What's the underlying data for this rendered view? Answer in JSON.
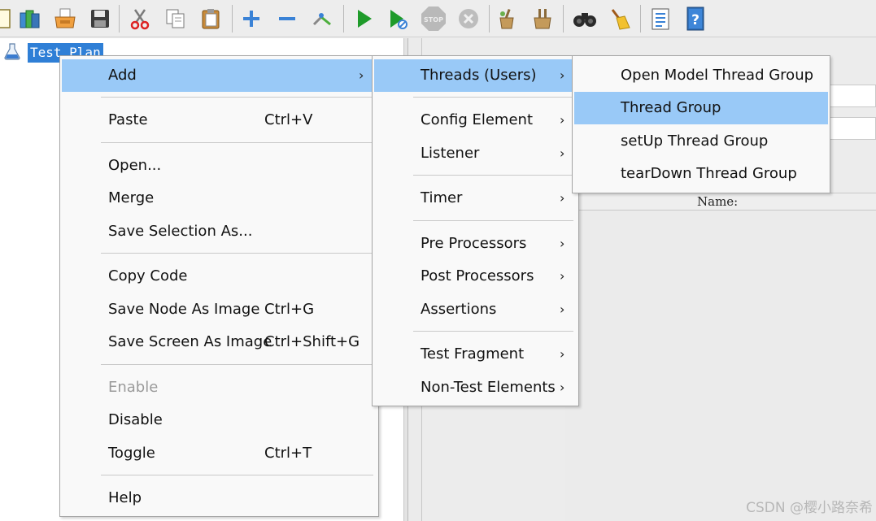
{
  "toolbar": {
    "buttons": [
      {
        "icon": "new-file-icon"
      },
      {
        "icon": "templates-icon"
      },
      {
        "icon": "open-icon"
      },
      {
        "icon": "save-icon"
      },
      {
        "icon": "cut-icon"
      },
      {
        "icon": "copy-icon"
      },
      {
        "icon": "paste-icon"
      },
      {
        "icon": "expand-icon"
      },
      {
        "icon": "collapse-icon"
      },
      {
        "icon": "toggle-icon"
      },
      {
        "icon": "start-icon"
      },
      {
        "icon": "start-no-pauses-icon"
      },
      {
        "icon": "stop-icon"
      },
      {
        "icon": "shutdown-icon"
      },
      {
        "icon": "clear-icon"
      },
      {
        "icon": "clear-all-icon"
      },
      {
        "icon": "search-icon"
      },
      {
        "icon": "reset-search-icon"
      },
      {
        "icon": "function-helper-icon"
      },
      {
        "icon": "help-icon"
      }
    ],
    "stop_text": "STOP"
  },
  "tree": {
    "root_label": "Test Plan"
  },
  "right_panel": {
    "name_label": "Name:"
  },
  "context_menu": {
    "items": [
      {
        "label": "Add",
        "shortcut": "",
        "submenu": true,
        "selected": true,
        "enabled": true
      },
      {
        "label": "Paste",
        "shortcut": "Ctrl+V",
        "submenu": false,
        "selected": false,
        "enabled": true
      },
      {
        "label": "Open...",
        "shortcut": "",
        "submenu": false,
        "selected": false,
        "enabled": true
      },
      {
        "label": "Merge",
        "shortcut": "",
        "submenu": false,
        "selected": false,
        "enabled": true
      },
      {
        "label": "Save Selection As...",
        "shortcut": "",
        "submenu": false,
        "selected": false,
        "enabled": true
      },
      {
        "label": "Copy Code",
        "shortcut": "",
        "submenu": false,
        "selected": false,
        "enabled": true
      },
      {
        "label": "Save Node As Image",
        "shortcut": "Ctrl+G",
        "submenu": false,
        "selected": false,
        "enabled": true
      },
      {
        "label": "Save Screen As Image",
        "shortcut": "Ctrl+Shift+G",
        "submenu": false,
        "selected": false,
        "enabled": true
      },
      {
        "label": "Enable",
        "shortcut": "",
        "submenu": false,
        "selected": false,
        "enabled": false
      },
      {
        "label": "Disable",
        "shortcut": "",
        "submenu": false,
        "selected": false,
        "enabled": true
      },
      {
        "label": "Toggle",
        "shortcut": "Ctrl+T",
        "submenu": false,
        "selected": false,
        "enabled": true
      },
      {
        "label": "Help",
        "shortcut": "",
        "submenu": false,
        "selected": false,
        "enabled": true
      }
    ]
  },
  "add_submenu": {
    "items": [
      {
        "label": "Threads (Users)",
        "selected": true
      },
      {
        "label": "Config Element",
        "selected": false
      },
      {
        "label": "Listener",
        "selected": false
      },
      {
        "label": "Timer",
        "selected": false
      },
      {
        "label": "Pre Processors",
        "selected": false
      },
      {
        "label": "Post Processors",
        "selected": false
      },
      {
        "label": "Assertions",
        "selected": false
      },
      {
        "label": "Test Fragment",
        "selected": false
      },
      {
        "label": "Non-Test Elements",
        "selected": false
      }
    ]
  },
  "threads_submenu": {
    "items": [
      {
        "label": "Open Model Thread Group",
        "selected": false
      },
      {
        "label": "Thread Group",
        "selected": true
      },
      {
        "label": "setUp Thread Group",
        "selected": false
      },
      {
        "label": "tearDown Thread Group",
        "selected": false
      }
    ]
  },
  "watermark": "CSDN @樱小路奈希",
  "colors": {
    "menu_highlight": "#99c9f7",
    "tree_selection": "#2f7fd6",
    "menu_background": "#f9f9f9",
    "disabled_text": "#9a9a9a"
  }
}
